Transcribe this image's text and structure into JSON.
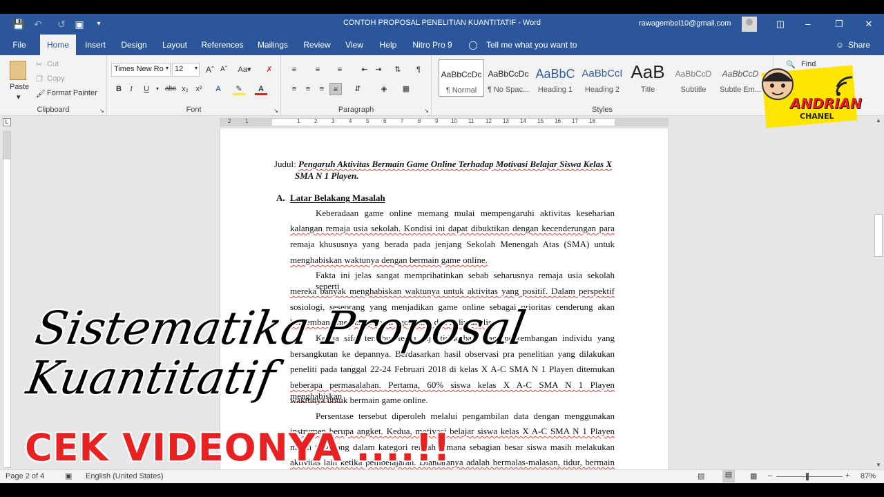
{
  "window": {
    "title": "CONTOH PROPOSAL PENELITIAN KUANTITATIF  -  Word",
    "user_email": "rawagembol10@gmail.com",
    "share_label": "Share"
  },
  "tabs": [
    {
      "label": "File"
    },
    {
      "label": "Home"
    },
    {
      "label": "Insert"
    },
    {
      "label": "Design"
    },
    {
      "label": "Layout"
    },
    {
      "label": "References"
    },
    {
      "label": "Mailings"
    },
    {
      "label": "Review"
    },
    {
      "label": "View"
    },
    {
      "label": "Help"
    },
    {
      "label": "Nitro Pro 9"
    }
  ],
  "tell_me": "Tell me what you want to do",
  "ribbon": {
    "clipboard": {
      "label": "Clipboard",
      "paste": "Paste",
      "cut": "Cut",
      "copy": "Copy",
      "format_painter": "Format Painter"
    },
    "font": {
      "label": "Font",
      "font_name": "Times New Ro",
      "font_size": "12"
    },
    "paragraph": {
      "label": "Paragraph"
    },
    "styles": {
      "label": "Styles",
      "items": [
        {
          "preview": "AaBbCcDc",
          "name": "¶ Normal"
        },
        {
          "preview": "AaBbCcDc",
          "name": "¶ No Spac..."
        },
        {
          "preview": "AaBbC",
          "name": "Heading 1"
        },
        {
          "preview": "AaBbCcI",
          "name": "Heading 2"
        },
        {
          "preview": "AaB",
          "name": "Title"
        },
        {
          "preview": "AaBbCcD",
          "name": "Subtitle"
        },
        {
          "preview": "AaBbCcD",
          "name": "Subtle Em..."
        }
      ]
    },
    "editing": {
      "find": "Find"
    }
  },
  "ruler": {
    "numbers": [
      "2",
      "1",
      "1",
      "2",
      "3",
      "4",
      "5",
      "6",
      "7",
      "8",
      "9",
      "10",
      "11",
      "12",
      "13",
      "14",
      "15",
      "16",
      "17",
      "18"
    ]
  },
  "document": {
    "title_prefix": "Judul: ",
    "title_italic": "Pengaruh Aktivitas Bermain Game Online Terhadap Motivasi Belajar Siswa Kelas X",
    "title_line2": "SMA N 1 Playen.",
    "section_letter": "A.",
    "section_title": "Latar Belakang Masalah",
    "lines": [
      "Keberadaan game online memang mulai mempengaruhi aktivitas keseharian",
      "kalangan remaja usia sekolah. Kondisi ini dapat dibuktikan dengan kecenderungan para",
      "remaja khususnya yang berada pada jenjang Sekolah Menengah Atas (SMA) untuk",
      "menghabiskan waktunya dengan bermain game online.",
      "Fakta ini jelas sangat memprihatinkan sebab seharusnya remaja usia sekolah seperti",
      "mereka banyak menghabiskan waktunya untuk aktivitas yang positif. Dalam perspektif",
      "sosiologi, seseorang yang menjadikan game online sebagai prioritas cenderung akan",
      "berkembang menjadi pribadi egosentris dan individualis.",
      "Kedua sifat tersebut tentu saja tidak baik bagi perkembangan individu yang",
      "bersangkutan ke depannya. Berdasarkan hasil observasi pra penelitian yang dilakukan",
      "peneliti pada tanggal 22-24 Februari 2018 di kelas X A-C SMA N 1 Playen ditemukan",
      "beberapa permasalahan. Pertama, 60% siswa kelas X A-C SMA N 1 Playen menghabiskan",
      "waktunya untuk bermain game online.",
      "Persentase tersebut diperoleh melalui pengambilan data dengan menggunakan",
      "instrumen berupa angket. Kedua, motivasi belajar siswa kelas X A-C SMA N 1 Playen",
      "masih tergolong dalam kategori rendah dimana sebagian besar siswa masih melakukan",
      "aktivitas lain ketika pembelajaran. Diantaranya adalah bermalas-malasan, tidur, bermain"
    ]
  },
  "statusbar": {
    "page": "Page 2 of 4",
    "language": "English (United States)",
    "zoom": "87%"
  },
  "overlay": {
    "title_line1": "Sistematika Proposal",
    "title_line2": "Kuantitatif",
    "cta": "CEK VIDEONYA ....!!",
    "logo_line1": "ANDRIAN",
    "logo_line2": "CHANEL"
  }
}
